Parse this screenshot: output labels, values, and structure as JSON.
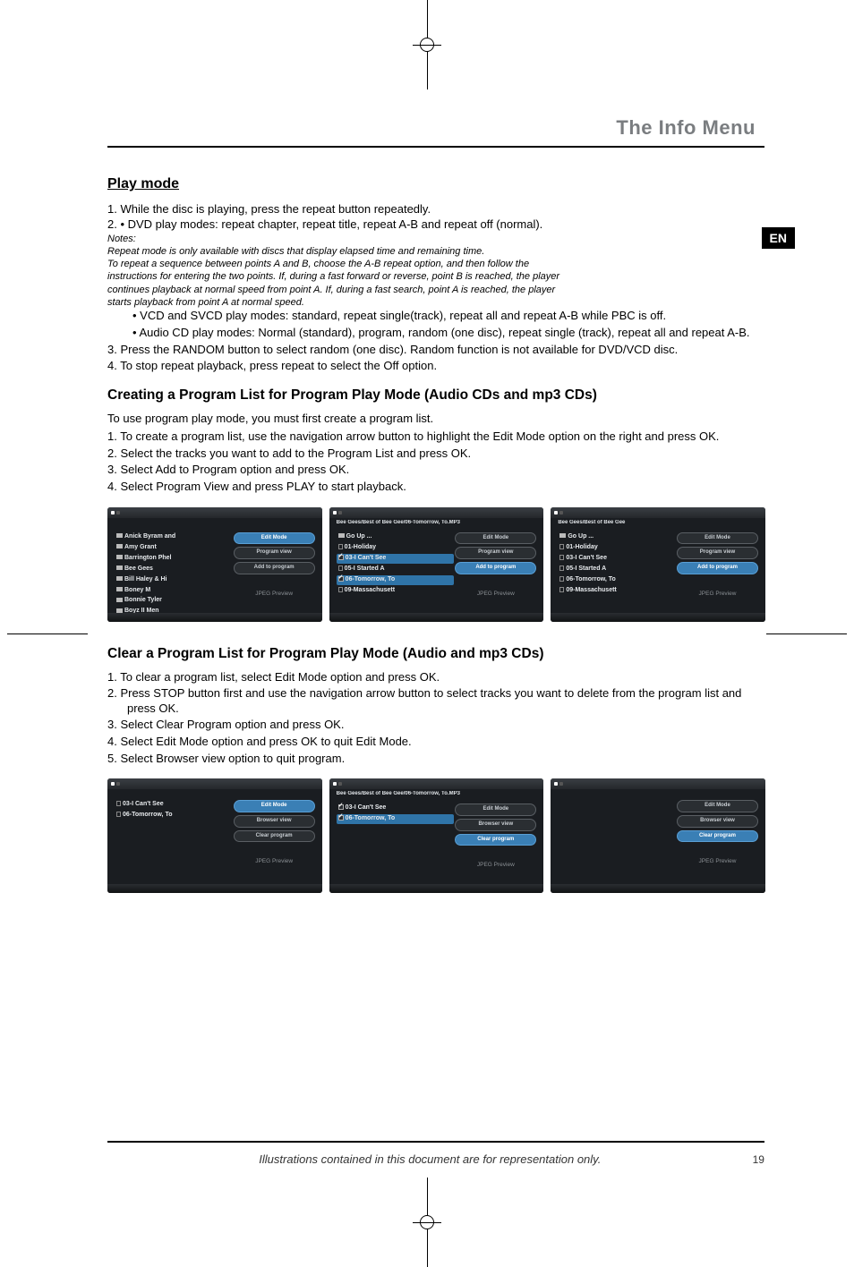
{
  "chapter_title": "The Info Menu",
  "en_label": "EN",
  "section1": {
    "title": "Play mode",
    "line1": "1. While the disc is playing, press the repeat button repeatedly.",
    "line2": "2. • DVD play modes: repeat chapter, repeat title, repeat A-B and repeat off (normal).",
    "notes_label": "Notes:",
    "notes_l1": "Repeat mode is only available with discs that display elapsed time and remaining time.",
    "notes_l2": "To repeat a sequence between points A and B, choose the A-B repeat option, and then follow the",
    "notes_l3": "instructions for entering the two points. If, during a fast forward or reverse, point B is reached, the player",
    "notes_l4": "continues playback at normal speed from point A. If, during a fast search, point A is reached, the player",
    "notes_l5": "starts playback from point A at normal speed.",
    "bullet1": "• VCD and SVCD play modes: standard, repeat single(track), repeat all and repeat A-B while PBC is off.",
    "bullet2": "• Audio CD play modes: Normal (standard), program, random (one disc), repeat single (track), repeat all and repeat A-B.",
    "line3": "3. Press the RANDOM button to select random (one disc). Random function is not available for DVD/VCD disc.",
    "line4": "4. To stop repeat playback, press repeat to select the Off option."
  },
  "section2": {
    "title": "Creating a Program List for Program Play Mode (Audio CDs and mp3 CDs)",
    "intro": "To use program play mode, you must first create a program list.",
    "s1": "1. To create a program list, use the navigation arrow button to highlight the Edit Mode option on the right and press OK.",
    "s2": "2. Select the tracks you want to add to the Program List and press OK.",
    "s3": "3. Select Add to Program option and press OK.",
    "s4": "4. Select Program View and press PLAY to start playback."
  },
  "shots_a": {
    "shot1": {
      "rows": [
        "Anick Byram and",
        "Amy Grant",
        "Barrington Phel",
        "Bee Gees",
        "Bill Haley & Hi",
        "Boney M",
        "Bonnie Tyler",
        "Boyz II Men"
      ],
      "btns": [
        "Edit Mode",
        "Program view",
        "Add to program"
      ],
      "sel_btn": 0,
      "jpeg": "JPEG Preview"
    },
    "shot2": {
      "bc": "Bee Gees/Best of Bee Gee/06-Tomorrow, To.MP3",
      "rows": [
        "Go Up ...",
        "01-Holiday",
        "03-I Can't See",
        "05-I Started A",
        "06-Tomorrow, To",
        "09-Massachusett"
      ],
      "hl_idx": [
        2,
        4
      ],
      "btns": [
        "Edit Mode",
        "Program view",
        "Add to program"
      ],
      "sel_btn": 2,
      "jpeg": "JPEG Preview"
    },
    "shot3": {
      "bc": "Bee Gees/Best of Bee Gee",
      "rows": [
        "Go Up ...",
        "01-Holiday",
        "03-I Can't See",
        "05-I Started A",
        "06-Tomorrow, To",
        "09-Massachusett"
      ],
      "btns": [
        "Edit Mode",
        "Program view",
        "Add to program"
      ],
      "sel_btn": 2,
      "jpeg": "JPEG Preview"
    }
  },
  "section3": {
    "title": "Clear a Program List for Program Play Mode (Audio and mp3 CDs)",
    "s1": "1. To clear a program list, select Edit Mode option and press OK.",
    "s2": "2. Press STOP button first and use the navigation arrow button to select tracks you want to delete from the program list and press OK.",
    "s3": "3. Select Clear Program option and press OK.",
    "s4": "4. Select Edit Mode option and press OK to quit Edit Mode.",
    "s5": "5. Select Browser view option to quit program."
  },
  "shots_b": {
    "shot1": {
      "rows": [
        "03-I Can't See",
        "06-Tomorrow, To"
      ],
      "btns": [
        "Edit Mode",
        "Browser view",
        "Clear program"
      ],
      "sel_btn": 0,
      "jpeg": "JPEG Preview"
    },
    "shot2": {
      "bc": "Bee Gees/Best of Bee Gee/06-Tomorrow, To.MP3",
      "rows": [
        "03-I Can't See",
        "06-Tomorrow, To"
      ],
      "chk": [
        true,
        true
      ],
      "hl_idx": [
        1
      ],
      "btns": [
        "Edit Mode",
        "Browser view",
        "Clear program"
      ],
      "sel_btn": 2,
      "jpeg": "JPEG Preview"
    },
    "shot3": {
      "rows": [],
      "btns": [
        "Edit Mode",
        "Browser view",
        "Clear program"
      ],
      "sel_btn": 2,
      "jpeg": "JPEG Preview"
    }
  },
  "footer_text": "Illustrations contained in this document are for representation only.",
  "page_no": "19"
}
